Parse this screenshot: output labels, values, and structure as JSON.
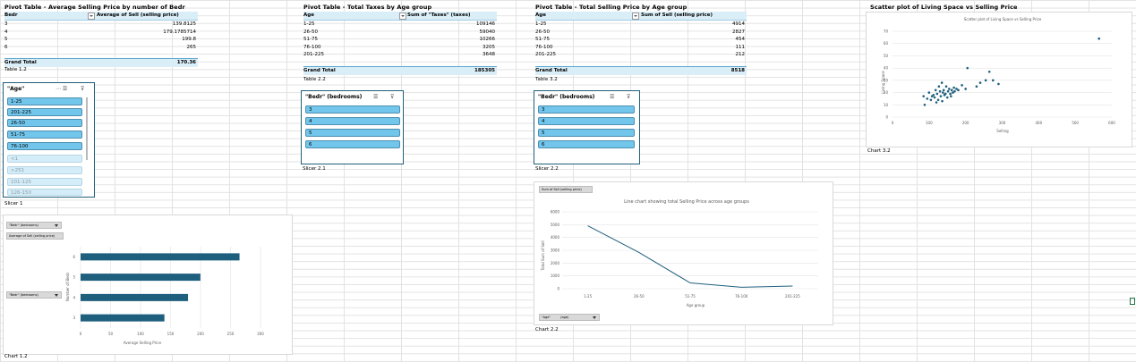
{
  "pivot1": {
    "title": "Pivot Table - Average Selling Price by number of Bedr",
    "col1": "Bedr",
    "col2": "Average of Sell (selling price)",
    "rows": [
      {
        "label": "3",
        "value": "139.8125"
      },
      {
        "label": "4",
        "value": "179.1785714"
      },
      {
        "label": "5",
        "value": "199.8"
      },
      {
        "label": "6",
        "value": "265"
      }
    ],
    "grand_label": "Grand Total",
    "grand_value": "170.36",
    "caption": "Table 1.2"
  },
  "pivot2": {
    "title": "Pivot Table - Total Taxes by Age group",
    "col1": "Age",
    "col2": "Sum of \"Taxes\" (taxes)",
    "rows": [
      {
        "label": "1-25",
        "value": "109146"
      },
      {
        "label": "26-50",
        "value": "59040"
      },
      {
        "label": "51-75",
        "value": "10266"
      },
      {
        "label": "76-100",
        "value": "3205"
      },
      {
        "label": "201-225",
        "value": "3648"
      }
    ],
    "grand_label": "Grand Total",
    "grand_value": "185305",
    "caption": "Table 2.2"
  },
  "pivot3": {
    "title": "Pivot Table - Total Selling Price by Age group",
    "col1": "Age",
    "col2": "Sum of Sell (selling price)",
    "rows": [
      {
        "label": "1-25",
        "value": "4914"
      },
      {
        "label": "26-50",
        "value": "2827"
      },
      {
        "label": "51-75",
        "value": "454"
      },
      {
        "label": "76-100",
        "value": "111"
      },
      {
        "label": "201-225",
        "value": "212"
      }
    ],
    "grand_label": "Grand Total",
    "grand_value": "8518",
    "caption": "Table 3.2"
  },
  "slicer1": {
    "title": "\"Age\"",
    "items": [
      {
        "label": "1-25",
        "selected": true
      },
      {
        "label": "201-225",
        "selected": true
      },
      {
        "label": "26-50",
        "selected": true
      },
      {
        "label": "51-75",
        "selected": true
      },
      {
        "label": "76-100",
        "selected": true
      },
      {
        "label": "<1",
        "selected": false
      },
      {
        "label": ">251",
        "selected": false
      },
      {
        "label": "101-125",
        "selected": false
      },
      {
        "label": "126-150",
        "selected": false
      }
    ],
    "caption": "Slicer 1"
  },
  "slicer2": {
    "title": "\"Bedr\" (bedrooms)",
    "items": [
      {
        "label": "3",
        "selected": true
      },
      {
        "label": "4",
        "selected": true
      },
      {
        "label": "5",
        "selected": true
      },
      {
        "label": "6",
        "selected": true
      }
    ],
    "caption": "Slicer 2.1"
  },
  "slicer3": {
    "title": "\"Bedr\" (bedrooms)",
    "items": [
      {
        "label": "3",
        "selected": true
      },
      {
        "label": "4",
        "selected": true
      },
      {
        "label": "5",
        "selected": true
      },
      {
        "label": "6",
        "selected": true
      }
    ],
    "caption": "Slicer 2.2"
  },
  "scatter": {
    "heading": "Scatter plot of Living Space vs Selling Price",
    "caption": "Chart 3.2"
  },
  "bar": {
    "filter1": "\"Bedr\" (bedrooms)",
    "filter2": "Average of Sell (selling price)",
    "filter3": "\"Bedr\" (bedrooms)",
    "caption": "Chart 1.2"
  },
  "line": {
    "filter1": "Sum of Sell (selling price)",
    "filter2a": "\"Age\"",
    "filter2b": "(age)",
    "caption": "Chart 2.2"
  },
  "colors": {
    "bar": "#1f5f7e",
    "line": "#1f5f7e",
    "slicer_on": "#72c6ec",
    "slicer_off": "#d4edf8",
    "pivot_header": "#daeef8"
  },
  "chart_data": [
    {
      "type": "scatter",
      "title": "Scatter plot of Living Space vs Selling Price",
      "xlabel": "Selling",
      "ylabel": "Living Space",
      "xlim": [
        0,
        600
      ],
      "ylim": [
        0,
        70
      ],
      "xticks": [
        0,
        100,
        200,
        300,
        400,
        500,
        600
      ],
      "yticks": [
        0,
        10,
        20,
        30,
        40,
        50,
        60,
        70
      ],
      "points": [
        [
          85,
          17
        ],
        [
          88,
          10
        ],
        [
          95,
          15
        ],
        [
          100,
          20
        ],
        [
          105,
          14
        ],
        [
          108,
          17
        ],
        [
          112,
          18
        ],
        [
          115,
          16
        ],
        [
          118,
          22
        ],
        [
          120,
          12
        ],
        [
          122,
          19
        ],
        [
          125,
          14
        ],
        [
          127,
          25
        ],
        [
          130,
          21
        ],
        [
          132,
          17
        ],
        [
          135,
          28
        ],
        [
          136,
          13
        ],
        [
          138,
          20
        ],
        [
          140,
          22
        ],
        [
          142,
          18
        ],
        [
          145,
          19
        ],
        [
          147,
          25
        ],
        [
          150,
          16
        ],
        [
          152,
          21
        ],
        [
          155,
          23
        ],
        [
          158,
          19
        ],
        [
          160,
          17
        ],
        [
          162,
          22
        ],
        [
          165,
          20
        ],
        [
          168,
          24
        ],
        [
          170,
          21
        ],
        [
          175,
          23
        ],
        [
          180,
          22
        ],
        [
          190,
          26
        ],
        [
          200,
          23
        ],
        [
          205,
          40
        ],
        [
          230,
          25
        ],
        [
          240,
          28
        ],
        [
          255,
          30
        ],
        [
          265,
          37
        ],
        [
          275,
          30
        ],
        [
          290,
          27
        ],
        [
          565,
          64
        ]
      ],
      "grid": true
    },
    {
      "type": "bar",
      "orientation": "horizontal",
      "xlabel": "Average Selling Price",
      "ylabel": "Number of Beds",
      "categories": [
        "3",
        "4",
        "5",
        "6"
      ],
      "values": [
        139.8125,
        179.1785714,
        199.8,
        265
      ],
      "xlim": [
        0,
        300
      ],
      "xticks": [
        0,
        50,
        100,
        150,
        200,
        250,
        300
      ]
    },
    {
      "type": "line",
      "title": "Line chart showing total Selling Price across age groups",
      "xlabel": "Age group",
      "ylabel": "Total Sum of Sell",
      "categories": [
        "1-25",
        "26-50",
        "51-75",
        "76-100",
        "201-225"
      ],
      "values": [
        4914,
        2827,
        454,
        111,
        212
      ],
      "ylim": [
        0,
        6000
      ],
      "yticks": [
        0,
        1000,
        2000,
        3000,
        4000,
        5000,
        6000
      ]
    }
  ]
}
